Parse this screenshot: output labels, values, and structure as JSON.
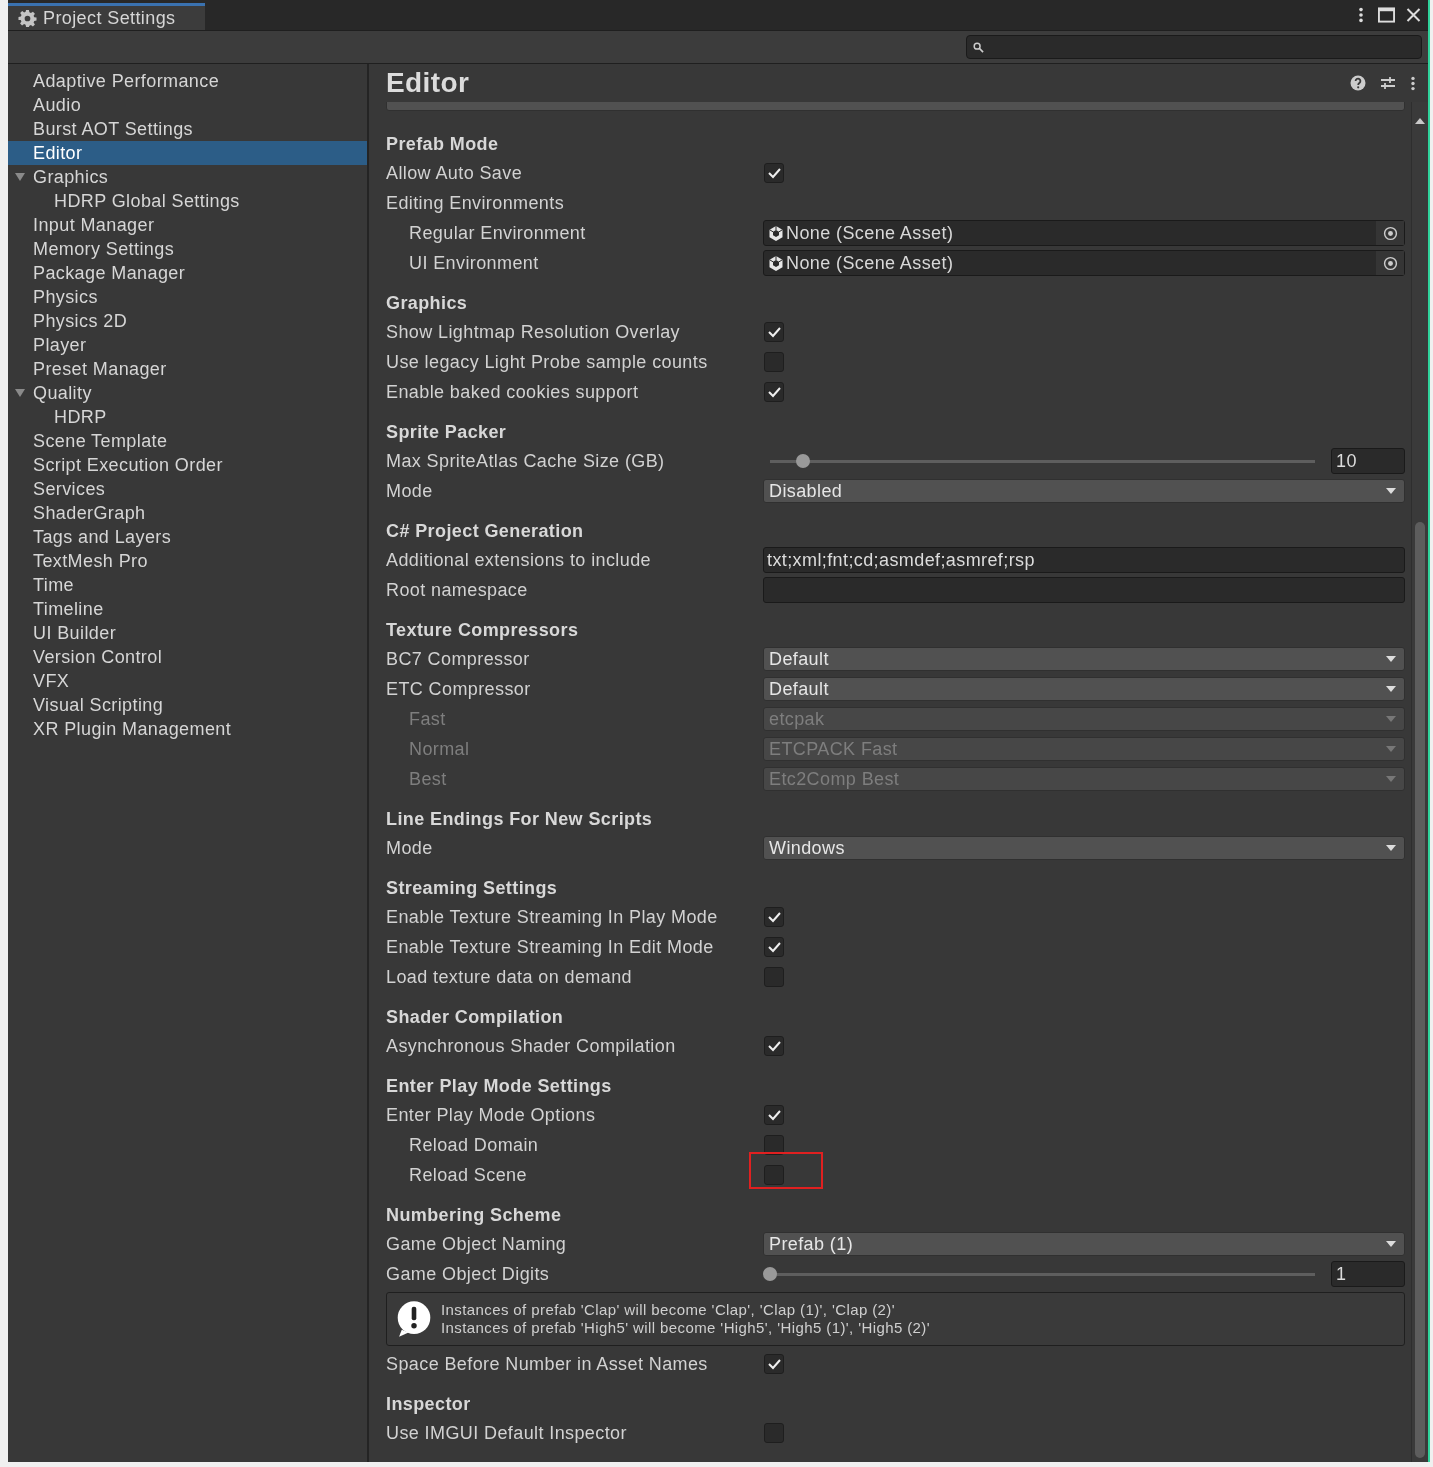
{
  "window": {
    "tab": "Project Settings"
  },
  "sidebar": {
    "items": [
      {
        "label": "Adaptive Performance",
        "selected": false
      },
      {
        "label": "Audio",
        "selected": false
      },
      {
        "label": "Burst AOT Settings",
        "selected": false
      },
      {
        "label": "Editor",
        "selected": true
      },
      {
        "label": "Graphics",
        "selected": false,
        "expanded": true,
        "children": [
          {
            "label": "HDRP Global Settings",
            "selected": false
          }
        ]
      },
      {
        "label": "Input Manager",
        "selected": false
      },
      {
        "label": "Memory Settings",
        "selected": false
      },
      {
        "label": "Package Manager",
        "selected": false
      },
      {
        "label": "Physics",
        "selected": false
      },
      {
        "label": "Physics 2D",
        "selected": false
      },
      {
        "label": "Player",
        "selected": false
      },
      {
        "label": "Preset Manager",
        "selected": false
      },
      {
        "label": "Quality",
        "selected": false,
        "expanded": true,
        "children": [
          {
            "label": "HDRP",
            "selected": false
          }
        ]
      },
      {
        "label": "Scene Template",
        "selected": false
      },
      {
        "label": "Script Execution Order",
        "selected": false
      },
      {
        "label": "Services",
        "selected": false
      },
      {
        "label": "ShaderGraph",
        "selected": false
      },
      {
        "label": "Tags and Layers",
        "selected": false
      },
      {
        "label": "TextMesh Pro",
        "selected": false
      },
      {
        "label": "Time",
        "selected": false
      },
      {
        "label": "Timeline",
        "selected": false
      },
      {
        "label": "UI Builder",
        "selected": false
      },
      {
        "label": "Version Control",
        "selected": false
      },
      {
        "label": "VFX",
        "selected": false
      },
      {
        "label": "Visual Scripting",
        "selected": false
      },
      {
        "label": "XR Plugin Management",
        "selected": false
      }
    ]
  },
  "panel": {
    "title": "Editor",
    "sections": [
      {
        "title": "Prefab Mode",
        "rows": [
          {
            "kind": "checkbox",
            "label": "Allow Auto Save",
            "checked": true
          },
          {
            "kind": "label",
            "label": "Editing Environments"
          },
          {
            "kind": "object",
            "label": "Regular Environment",
            "indented": true,
            "value": "None (Scene Asset)"
          },
          {
            "kind": "object",
            "label": "UI Environment",
            "indented": true,
            "value": "None (Scene Asset)"
          }
        ]
      },
      {
        "title": "Graphics",
        "rows": [
          {
            "kind": "checkbox",
            "label": "Show Lightmap Resolution Overlay",
            "checked": true
          },
          {
            "kind": "checkbox",
            "label": "Use legacy Light Probe sample counts",
            "checked": false
          },
          {
            "kind": "checkbox",
            "label": "Enable baked cookies support",
            "checked": true
          }
        ]
      },
      {
        "title": "Sprite Packer",
        "rows": [
          {
            "kind": "slider",
            "label": "Max SpriteAtlas Cache Size (GB)",
            "level": 0.06,
            "value": "10"
          },
          {
            "kind": "dropdown",
            "label": "Mode",
            "value": "Disabled",
            "disabled": false
          }
        ]
      },
      {
        "title": "C# Project Generation",
        "rows": [
          {
            "kind": "text",
            "label": "Additional extensions to include",
            "value": "txt;xml;fnt;cd;asmdef;asmref;rsp"
          },
          {
            "kind": "text",
            "label": "Root namespace"
          }
        ]
      },
      {
        "title": "Texture Compressors",
        "rows": [
          {
            "kind": "dropdown",
            "label": "BC7 Compressor",
            "value": "Default",
            "disabled": false
          },
          {
            "kind": "dropdown",
            "label": "ETC Compressor",
            "value": "Default",
            "disabled": false
          },
          {
            "kind": "dropdown",
            "label": "Fast",
            "indented": true,
            "value": "etcpak",
            "disabled": true
          },
          {
            "kind": "dropdown",
            "label": "Normal",
            "indented": true,
            "value": "ETCPACK Fast",
            "disabled": true
          },
          {
            "kind": "dropdown",
            "label": "Best",
            "indented": true,
            "value": "Etc2Comp Best",
            "disabled": true
          }
        ]
      },
      {
        "title": "Line Endings For New Scripts",
        "rows": [
          {
            "kind": "dropdown",
            "label": "Mode",
            "value": "Windows",
            "disabled": false
          }
        ]
      },
      {
        "title": "Streaming Settings",
        "rows": [
          {
            "kind": "checkbox",
            "label": "Enable Texture Streaming In Play Mode",
            "checked": true
          },
          {
            "kind": "checkbox",
            "label": "Enable Texture Streaming In Edit Mode",
            "checked": true
          },
          {
            "kind": "checkbox",
            "label": "Load texture data on demand",
            "checked": false
          }
        ]
      },
      {
        "title": "Shader Compilation",
        "rows": [
          {
            "kind": "checkbox",
            "label": "Asynchronous Shader Compilation",
            "checked": true
          }
        ]
      },
      {
        "title": "Enter Play Mode Settings",
        "rows": [
          {
            "kind": "checkbox",
            "label": "Enter Play Mode Options",
            "checked": true
          },
          {
            "kind": "checkbox",
            "label": "Reload Domain",
            "indented": true,
            "checked": false
          },
          {
            "kind": "checkbox",
            "label": "Reload Scene",
            "indented": true,
            "checked": false,
            "highlighted": true
          }
        ]
      },
      {
        "title": "Numbering Scheme",
        "rows": [
          {
            "kind": "dropdown",
            "label": "Game Object Naming",
            "value": "Prefab (1)",
            "disabled": false
          },
          {
            "kind": "slider",
            "label": "Game Object Digits",
            "level": 0.0,
            "value": "1"
          },
          {
            "kind": "helpbox",
            "lines": [
              "Instances of prefab 'Clap' will become 'Clap', 'Clap (1)', 'Clap (2)'",
              "Instances of prefab 'High5' will become 'High5', 'High5 (1)', 'High5 (2)'"
            ]
          },
          {
            "kind": "checkbox",
            "label": "Space Before Number in Asset Names",
            "checked": true
          }
        ]
      },
      {
        "title": "Inspector",
        "rows": [
          {
            "kind": "checkbox",
            "label": "Use IMGUI Default Inspector",
            "checked": false
          }
        ]
      }
    ]
  }
}
